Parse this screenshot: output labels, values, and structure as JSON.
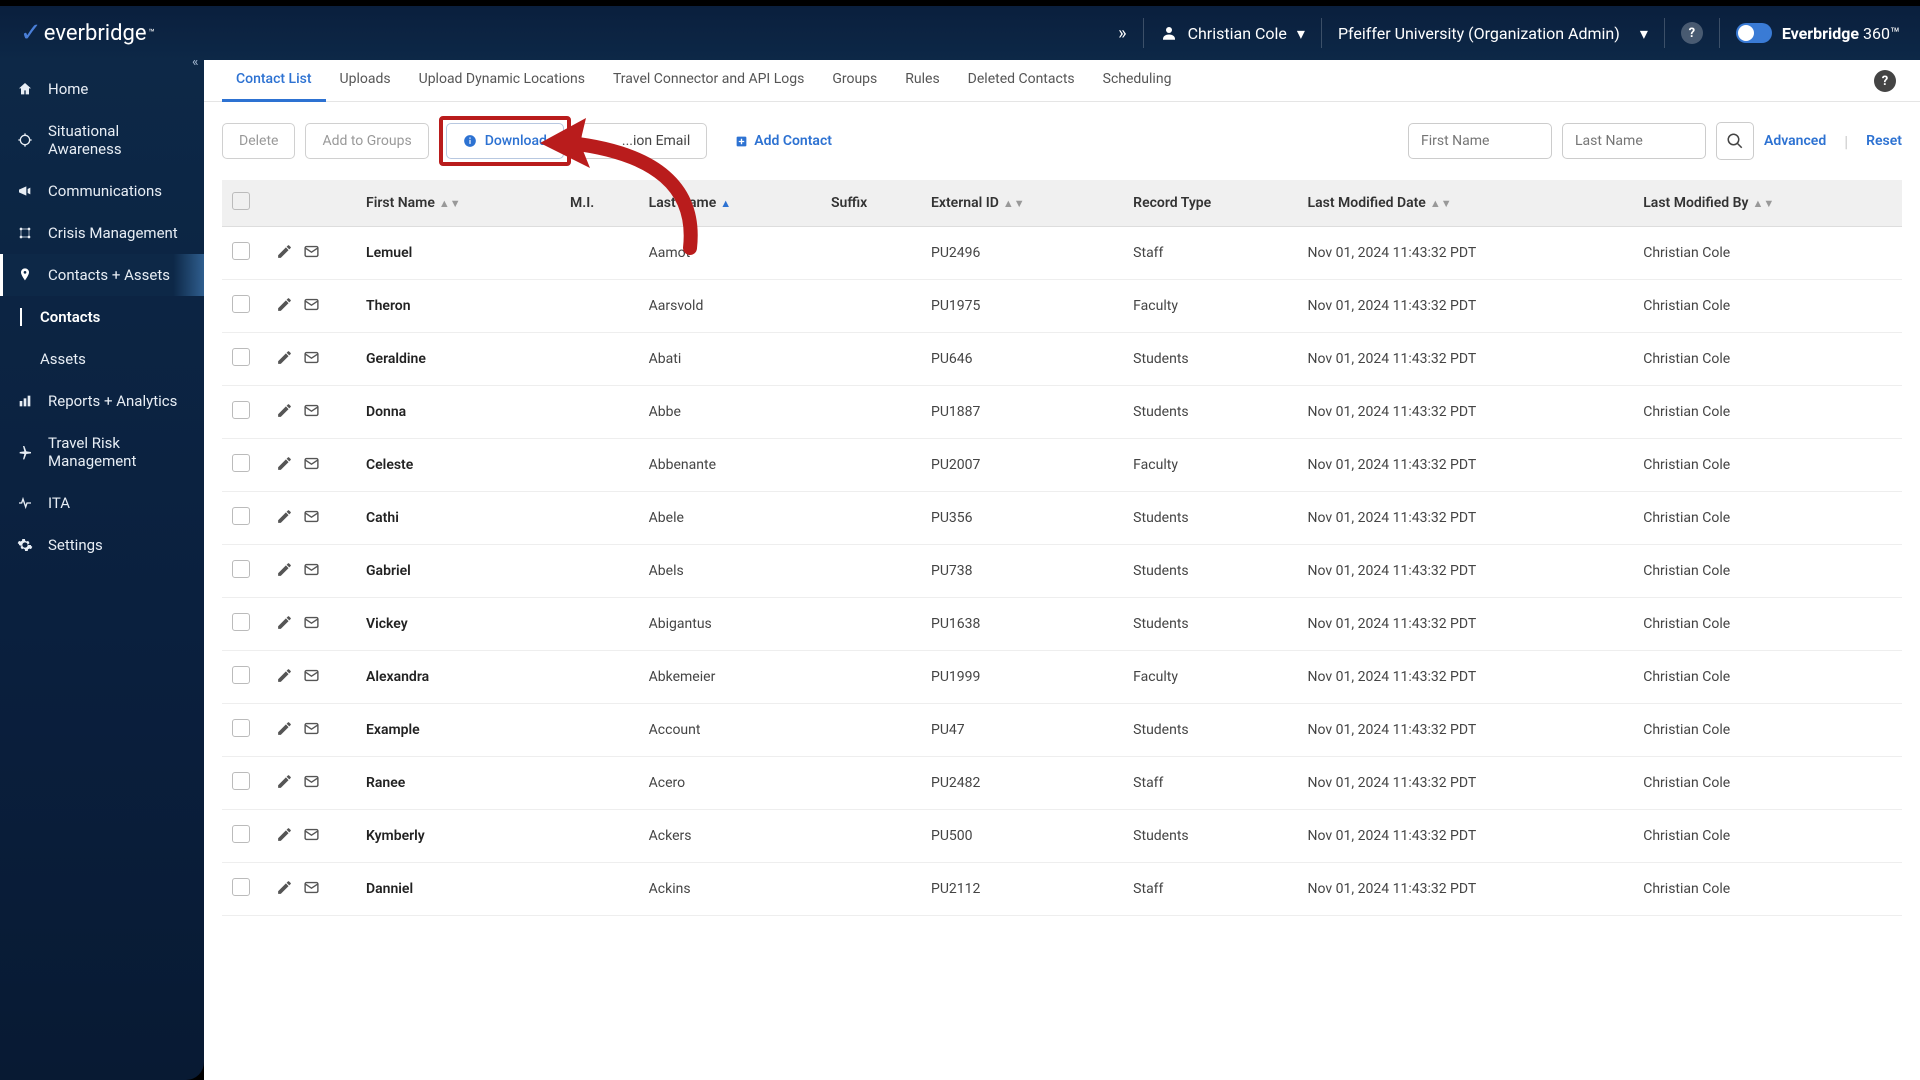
{
  "header": {
    "brand": "everbridge",
    "user_name": "Christian Cole",
    "org_name": "Pfeiffer University (Organization Admin)",
    "brand360_prefix": "Everbridge",
    "brand360_suffix": "360™"
  },
  "sidebar": {
    "items": [
      {
        "label": "Home"
      },
      {
        "label": "Situational Awareness"
      },
      {
        "label": "Communications"
      },
      {
        "label": "Crisis Management"
      },
      {
        "label": "Contacts + Assets"
      },
      {
        "label": "Reports + Analytics"
      },
      {
        "label": "Travel Risk Management"
      },
      {
        "label": "ITA"
      },
      {
        "label": "Settings"
      }
    ],
    "sub_contacts": "Contacts",
    "sub_assets": "Assets"
  },
  "tabs": [
    {
      "label": "Contact List"
    },
    {
      "label": "Uploads"
    },
    {
      "label": "Upload Dynamic Locations"
    },
    {
      "label": "Travel Connector and API Logs"
    },
    {
      "label": "Groups"
    },
    {
      "label": "Rules"
    },
    {
      "label": "Deleted Contacts"
    },
    {
      "label": "Scheduling"
    }
  ],
  "toolbar": {
    "delete": "Delete",
    "add_groups": "Add to Groups",
    "download": "Download",
    "reg_email": "...ion Email",
    "add_contact": "Add Contact",
    "first_placeholder": "First Name",
    "last_placeholder": "Last Name",
    "advanced": "Advanced",
    "reset": "Reset"
  },
  "columns": {
    "first": "First Name",
    "mi": "M.I.",
    "last": "Last Name",
    "suffix": "Suffix",
    "ext": "External ID",
    "record": "Record Type",
    "modified": "Last Modified Date",
    "by": "Last Modified By"
  },
  "rows": [
    {
      "first": "Lemuel",
      "last": "Aamot",
      "ext": "PU2496",
      "record": "Staff",
      "modified": "Nov 01, 2024 11:43:32 PDT",
      "by": "Christian Cole"
    },
    {
      "first": "Theron",
      "last": "Aarsvold",
      "ext": "PU1975",
      "record": "Faculty",
      "modified": "Nov 01, 2024 11:43:32 PDT",
      "by": "Christian Cole"
    },
    {
      "first": "Geraldine",
      "last": "Abati",
      "ext": "PU646",
      "record": "Students",
      "modified": "Nov 01, 2024 11:43:32 PDT",
      "by": "Christian Cole"
    },
    {
      "first": "Donna",
      "last": "Abbe",
      "ext": "PU1887",
      "record": "Students",
      "modified": "Nov 01, 2024 11:43:32 PDT",
      "by": "Christian Cole"
    },
    {
      "first": "Celeste",
      "last": "Abbenante",
      "ext": "PU2007",
      "record": "Faculty",
      "modified": "Nov 01, 2024 11:43:32 PDT",
      "by": "Christian Cole"
    },
    {
      "first": "Cathi",
      "last": "Abele",
      "ext": "PU356",
      "record": "Students",
      "modified": "Nov 01, 2024 11:43:32 PDT",
      "by": "Christian Cole"
    },
    {
      "first": "Gabriel",
      "last": "Abels",
      "ext": "PU738",
      "record": "Students",
      "modified": "Nov 01, 2024 11:43:32 PDT",
      "by": "Christian Cole"
    },
    {
      "first": "Vickey",
      "last": "Abigantus",
      "ext": "PU1638",
      "record": "Students",
      "modified": "Nov 01, 2024 11:43:32 PDT",
      "by": "Christian Cole"
    },
    {
      "first": "Alexandra",
      "last": "Abkemeier",
      "ext": "PU1999",
      "record": "Faculty",
      "modified": "Nov 01, 2024 11:43:32 PDT",
      "by": "Christian Cole"
    },
    {
      "first": "Example",
      "last": "Account",
      "ext": "PU47",
      "record": "Students",
      "modified": "Nov 01, 2024 11:43:32 PDT",
      "by": "Christian Cole"
    },
    {
      "first": "Ranee",
      "last": "Acero",
      "ext": "PU2482",
      "record": "Staff",
      "modified": "Nov 01, 2024 11:43:32 PDT",
      "by": "Christian Cole"
    },
    {
      "first": "Kymberly",
      "last": "Ackers",
      "ext": "PU500",
      "record": "Students",
      "modified": "Nov 01, 2024 11:43:32 PDT",
      "by": "Christian Cole"
    },
    {
      "first": "Danniel",
      "last": "Ackins",
      "ext": "PU2112",
      "record": "Staff",
      "modified": "Nov 01, 2024 11:43:32 PDT",
      "by": "Christian Cole"
    }
  ]
}
